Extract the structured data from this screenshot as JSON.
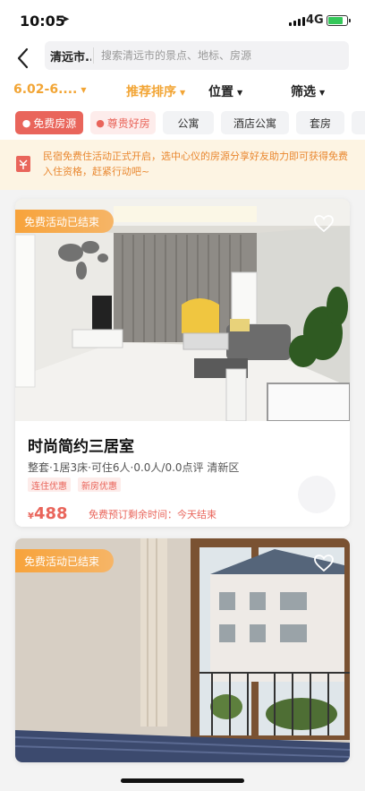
{
  "status": {
    "time": "10:05",
    "network": "4G"
  },
  "search": {
    "city": "清远市...",
    "placeholder": "搜索清远市的景点、地标、房源"
  },
  "filters": {
    "date": "6.02-6....",
    "sort": "推荐排序",
    "location": "位置",
    "filter": "筛选"
  },
  "tags": [
    "免费房源",
    "尊贵好房",
    "公寓",
    "酒店公寓",
    "套房"
  ],
  "notice": {
    "text": "民宿免费住活动正式开启，选中心仪的房源分享好友助力即可获得免费入住资格，赶紧行动吧~"
  },
  "listings": [
    {
      "ribbon": "免费活动已结束",
      "title": "时尚简约三居室",
      "meta": "整套·1居3床·可住6人·0.0人/0.0点评 清新区",
      "badges": [
        "连住优惠",
        "新房优惠"
      ],
      "currency": "¥",
      "price": "488",
      "countdown": "免费预订剩余时间：今天结束"
    },
    {
      "ribbon": "免费活动已结束"
    }
  ],
  "colors": {
    "accent": "#e9655b",
    "orange": "#f2a535",
    "notice_bg": "#fdf4e3"
  }
}
